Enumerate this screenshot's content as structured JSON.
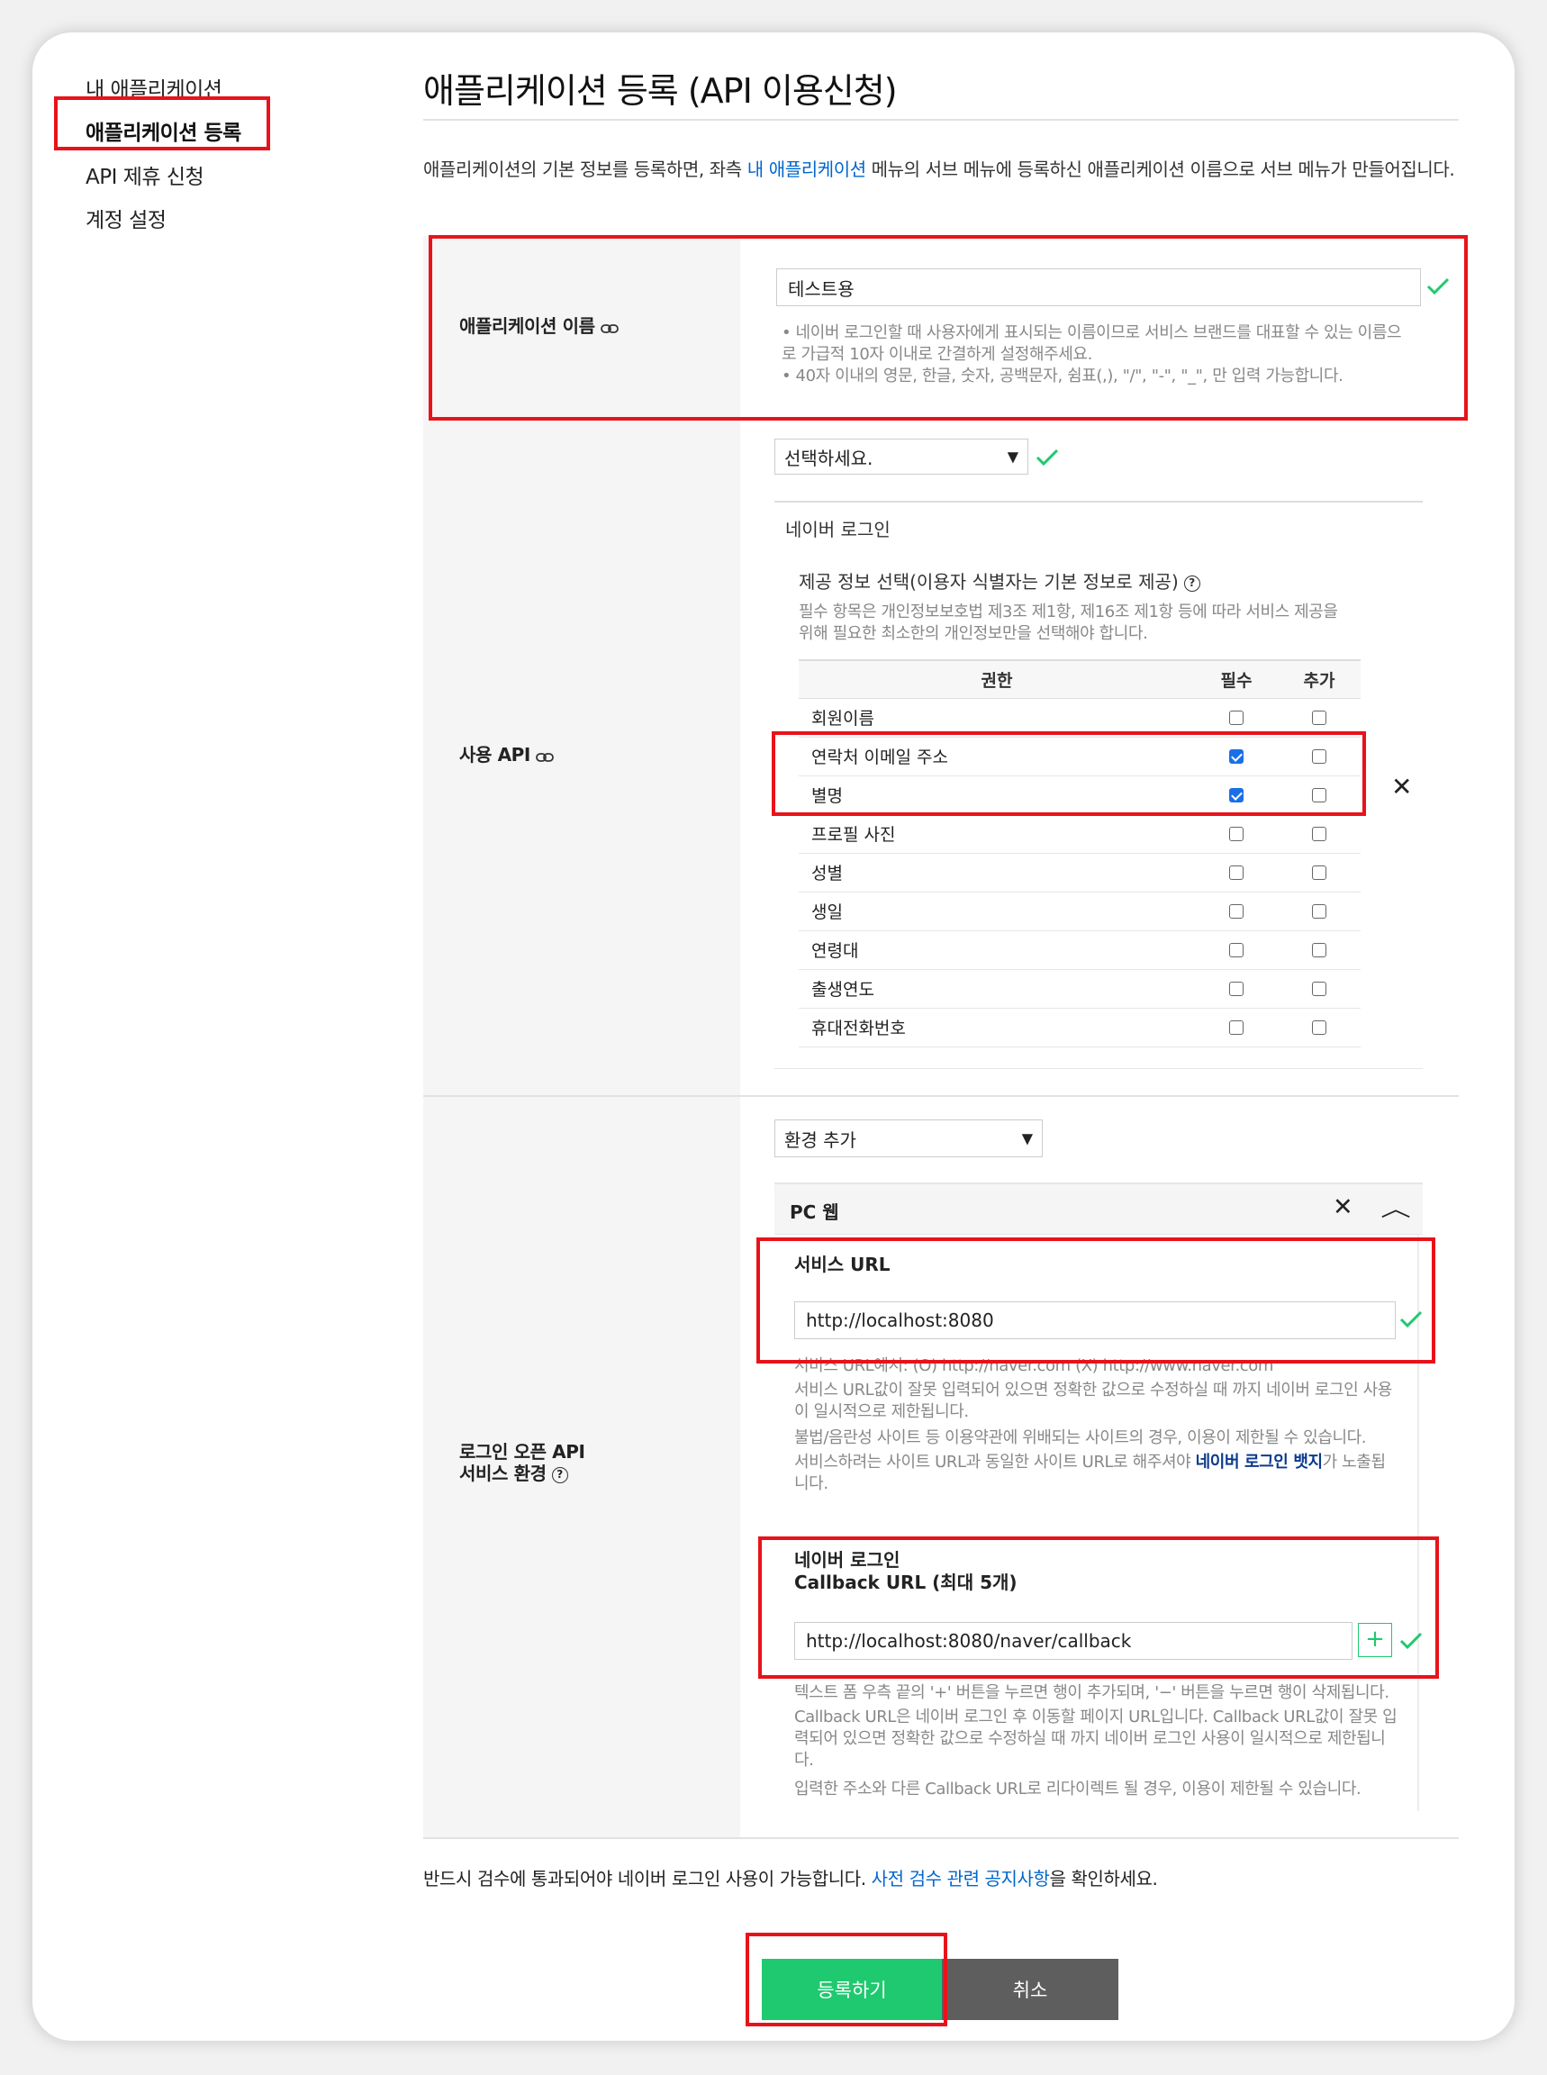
{
  "sidebar": {
    "items": [
      {
        "label": "내 애플리케이션"
      },
      {
        "label": "애플리케이션 등록"
      },
      {
        "label": "API 제휴 신청"
      },
      {
        "label": "계정 설정"
      }
    ]
  },
  "page": {
    "title": "애플리케이션 등록 (API 이용신청)",
    "desc_part1": "애플리케이션의 기본 정보를 등록하면, 좌측 ",
    "desc_link": "내 애플리케이션",
    "desc_part2": " 메뉴의 서브 메뉴에 등록하신 애플리케이션 이름으로 서브 메뉴가 만들어집니다."
  },
  "app_name": {
    "label": "애플리케이션 이름",
    "value": "테스트용",
    "notes": [
      "• 네이버 로그인할 때 사용자에게 표시되는 이름이므로 서비스 브랜드를 대표할 수 있는 이름으로 가급적 10자 이내로 간결하게 설정해주세요.",
      "• 40자 이내의 영문, 한글, 숫자, 공백문자, 쉼표(,), \"/\", \"-\", \"_\", 만 입력 가능합니다."
    ]
  },
  "use_api": {
    "label": "사용 API",
    "select_value": "선택하세요.",
    "api_name": "네이버 로그인",
    "provide_title": "제공 정보 선택(이용자 식별자는 기본 정보로 제공)",
    "provide_note": "필수 항목은 개인정보보호법 제3조 제1항, 제16조 제1항 등에 따라 서비스 제공을 위해 필요한 최소한의 개인정보만을 선택해야 합니다.",
    "columns": [
      "권한",
      "필수",
      "추가"
    ],
    "rows": [
      {
        "name": "회원이름",
        "required": false,
        "extra": false
      },
      {
        "name": "연락처 이메일 주소",
        "required": true,
        "extra": false
      },
      {
        "name": "별명",
        "required": true,
        "extra": false
      },
      {
        "name": "프로필 사진",
        "required": false,
        "extra": false
      },
      {
        "name": "성별",
        "required": false,
        "extra": false
      },
      {
        "name": "생일",
        "required": false,
        "extra": false
      },
      {
        "name": "연령대",
        "required": false,
        "extra": false
      },
      {
        "name": "출생연도",
        "required": false,
        "extra": false
      },
      {
        "name": "휴대전화번호",
        "required": false,
        "extra": false
      }
    ]
  },
  "env": {
    "label_line1": "로그인 오픈 API",
    "label_line2": "서비스 환경",
    "select_value": "환경 추가",
    "panel_title": "PC 웹",
    "service_url_label": "서비스 URL",
    "service_url_value": "http://localhost:8080",
    "service_notes": [
      "서비스 URL예시: (O) http://naver.com (X) http://www.naver.com",
      "서비스 URL값이 잘못 입력되어 있으면 정확한 값으로 수정하실 때 까지 네이버 로그인 사용이 일시적으로 제한됩니다.",
      "불법/음란성 사이트 등 이용약관에 위배되는 사이트의 경우, 이용이 제한될 수 있습니다."
    ],
    "service_note_last_part1": "서비스하려는 사이트 URL과 동일한 사이트 URL로 해주셔야 ",
    "service_note_last_link": "네이버 로그인 뱃지",
    "service_note_last_part2": "가 노출됩니다.",
    "callback_label_line1": "네이버 로그인",
    "callback_label_line2": "Callback URL (최대 5개)",
    "callback_value": "http://localhost:8080/naver/callback",
    "callback_add": "+",
    "callback_notes": [
      "텍스트 폼 우측 끝의 '+' 버튼을 누르면 행이 추가되며, '−' 버튼을 누르면 행이 삭제됩니다.",
      "Callback URL은 네이버 로그인 후 이동할 페이지 URL입니다. Callback URL값이 잘못 입력되어 있으면 정확한 값으로 수정하실 때 까지 네이버 로그인 사용이 일시적으로 제한됩니다.",
      "입력한 주소와 다른 Callback URL로 리다이렉트 될 경우, 이용이 제한될 수 있습니다."
    ]
  },
  "footer": {
    "notice_part1": "반드시 검수에 통과되어야 네이버 로그인 사용이 가능합니다. ",
    "notice_link": "사전 검수 관련 공지사항",
    "notice_part2": "을 확인하세요.",
    "submit": "등록하기",
    "cancel": "취소"
  },
  "colors": {
    "accent_green": "#1fc96f",
    "link_blue": "#0066cc",
    "annotation_red": "#e8131a",
    "cancel_gray": "#5e5e5e"
  }
}
